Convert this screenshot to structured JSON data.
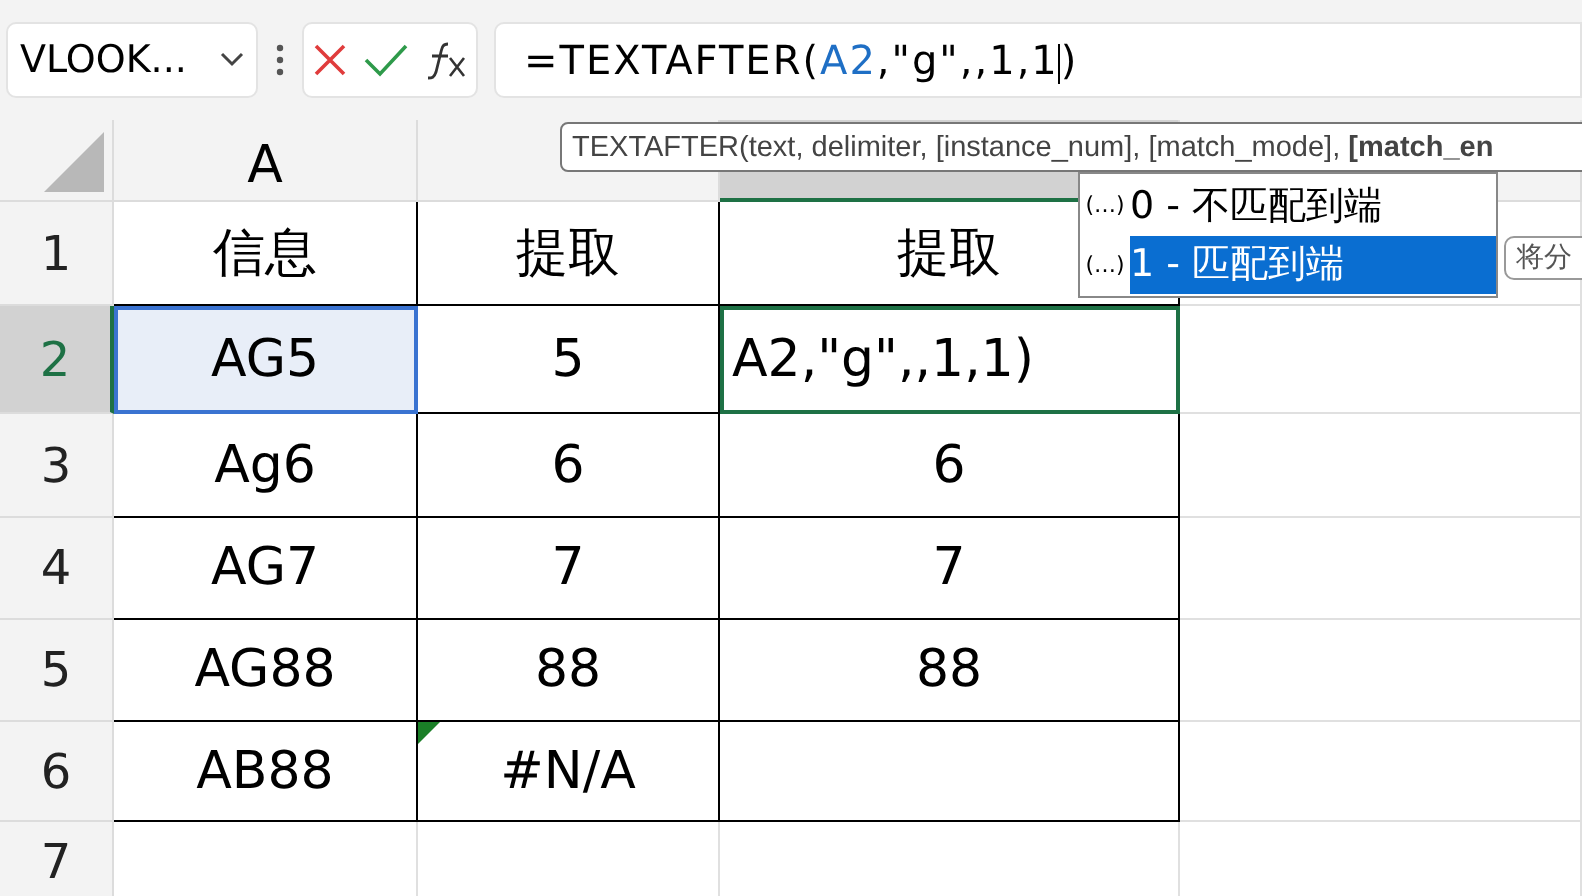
{
  "name_box": {
    "value": "VLOOK..."
  },
  "formula_bar": {
    "parts": [
      {
        "kind": "plain",
        "text": "=TEXTAFTER("
      },
      {
        "kind": "ref",
        "text": "A2"
      },
      {
        "kind": "plain",
        "text": ",\"g\",,1,1"
      },
      {
        "kind": "cursor"
      },
      {
        "kind": "plain",
        "text": ")"
      }
    ]
  },
  "tooltip": {
    "text": "TEXTAFTER(text, delimiter, [instance_num], [match_mode], **[match_en**"
  },
  "dropdown": {
    "items": [
      {
        "marker": "(…)",
        "label": "0 - 不匹配到端",
        "selected": false
      },
      {
        "marker": "(…)",
        "label": "1 - 匹配到端",
        "selected": true
      }
    ],
    "hint": "将分"
  },
  "columns": [
    {
      "label": "A",
      "selected": false
    },
    {
      "selected": false
    },
    {
      "selected": true
    }
  ],
  "rows": [
    {
      "header": "1",
      "selected": false,
      "cells": [
        {
          "text": "信息"
        },
        {
          "text": "提取"
        },
        {
          "text": "提取"
        }
      ]
    },
    {
      "header": "2",
      "selected": true,
      "cells": [
        {
          "text": "AG5",
          "referenced": true
        },
        {
          "text": "5"
        },
        {
          "text": "A2,\"g\",,1,1)",
          "editing": true
        }
      ]
    },
    {
      "header": "3",
      "selected": false,
      "cells": [
        {
          "text": "Ag6"
        },
        {
          "text": "6"
        },
        {
          "text": "6"
        }
      ]
    },
    {
      "header": "4",
      "selected": false,
      "cells": [
        {
          "text": "AG7"
        },
        {
          "text": "7"
        },
        {
          "text": "7"
        }
      ]
    },
    {
      "header": "5",
      "selected": false,
      "cells": [
        {
          "text": "AG88"
        },
        {
          "text": "88"
        },
        {
          "text": "88"
        }
      ]
    },
    {
      "header": "6",
      "selected": false,
      "cells": [
        {
          "text": "AB88"
        },
        {
          "text": "#N/A",
          "error_marker": true
        },
        {}
      ]
    },
    {
      "header": "7",
      "selected": false,
      "cells": []
    }
  ]
}
